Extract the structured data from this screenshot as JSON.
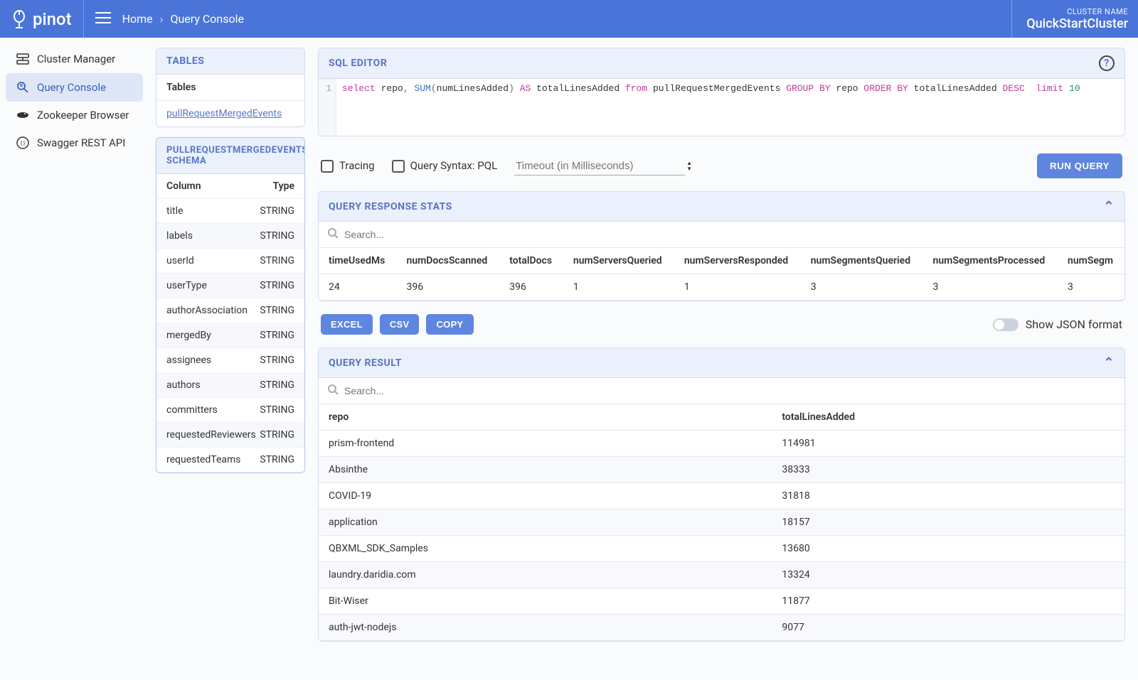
{
  "brand": "pinot",
  "breadcrumb": {
    "home": "Home",
    "current": "Query Console"
  },
  "cluster": {
    "label": "CLUSTER NAME",
    "name": "QuickStartCluster"
  },
  "nav": [
    {
      "label": "Cluster Manager",
      "icon": "cluster",
      "active": false
    },
    {
      "label": "Query Console",
      "icon": "query",
      "active": true
    },
    {
      "label": "Zookeeper Browser",
      "icon": "zk",
      "active": false
    },
    {
      "label": "Swagger REST API",
      "icon": "swagger",
      "active": false
    }
  ],
  "tables_panel": {
    "title": "TABLES",
    "subheader": "Tables",
    "items": [
      "pullRequestMergedEvents"
    ]
  },
  "schema_panel": {
    "title": "PULLREQUESTMERGEDEVENTS SCHEMA",
    "headers": {
      "col": "Column",
      "type": "Type"
    },
    "rows": [
      {
        "col": "title",
        "type": "STRING"
      },
      {
        "col": "labels",
        "type": "STRING"
      },
      {
        "col": "userId",
        "type": "STRING"
      },
      {
        "col": "userType",
        "type": "STRING"
      },
      {
        "col": "authorAssociation",
        "type": "STRING"
      },
      {
        "col": "mergedBy",
        "type": "STRING"
      },
      {
        "col": "assignees",
        "type": "STRING"
      },
      {
        "col": "authors",
        "type": "STRING"
      },
      {
        "col": "committers",
        "type": "STRING"
      },
      {
        "col": "requestedReviewers",
        "type": "STRING"
      },
      {
        "col": "requestedTeams",
        "type": "STRING"
      }
    ]
  },
  "sql_editor": {
    "title": "SQL EDITOR",
    "line_no": "1",
    "tokens": [
      {
        "t": "select ",
        "c": "kw"
      },
      {
        "t": "repo",
        "c": "id"
      },
      {
        "t": ", ",
        "c": "p"
      },
      {
        "t": "SUM",
        "c": "func"
      },
      {
        "t": "(",
        "c": "p"
      },
      {
        "t": "numLinesAdded",
        "c": "id"
      },
      {
        "t": ")",
        "c": "p"
      },
      {
        "t": " AS ",
        "c": "as"
      },
      {
        "t": "totalLinesAdded ",
        "c": "id"
      },
      {
        "t": "from ",
        "c": "kw"
      },
      {
        "t": "pullRequestMergedEvents ",
        "c": "id"
      },
      {
        "t": "GROUP BY ",
        "c": "kw"
      },
      {
        "t": "repo ",
        "c": "id"
      },
      {
        "t": "ORDER BY ",
        "c": "kw"
      },
      {
        "t": "totalLinesAdded ",
        "c": "id"
      },
      {
        "t": "DESC  ",
        "c": "kw"
      },
      {
        "t": "limit ",
        "c": "kw"
      },
      {
        "t": "10",
        "c": "num"
      }
    ]
  },
  "controls": {
    "tracing": "Tracing",
    "pql": "Query Syntax: PQL",
    "timeout_placeholder": "Timeout (in Milliseconds)",
    "run": "RUN QUERY"
  },
  "stats": {
    "title": "QUERY RESPONSE STATS",
    "search_placeholder": "Search...",
    "headers": [
      "timeUsedMs",
      "numDocsScanned",
      "totalDocs",
      "numServersQueried",
      "numServersResponded",
      "numSegmentsQueried",
      "numSegmentsProcessed",
      "numSegm"
    ],
    "row": [
      "24",
      "396",
      "396",
      "1",
      "1",
      "3",
      "3",
      "3"
    ]
  },
  "export": {
    "excel": "EXCEL",
    "csv": "CSV",
    "copy": "COPY",
    "json_label": "Show JSON format"
  },
  "result": {
    "title": "QUERY RESULT",
    "search_placeholder": "Search...",
    "headers": [
      "repo",
      "totalLinesAdded"
    ],
    "rows": [
      [
        "prism-frontend",
        "114981"
      ],
      [
        "Absinthe",
        "38333"
      ],
      [
        "COVID-19",
        "31818"
      ],
      [
        "application",
        "18157"
      ],
      [
        "QBXML_SDK_Samples",
        "13680"
      ],
      [
        "laundry.daridia.com",
        "13324"
      ],
      [
        "Bit-Wiser",
        "11877"
      ],
      [
        "auth-jwt-nodejs",
        "9077"
      ]
    ]
  }
}
